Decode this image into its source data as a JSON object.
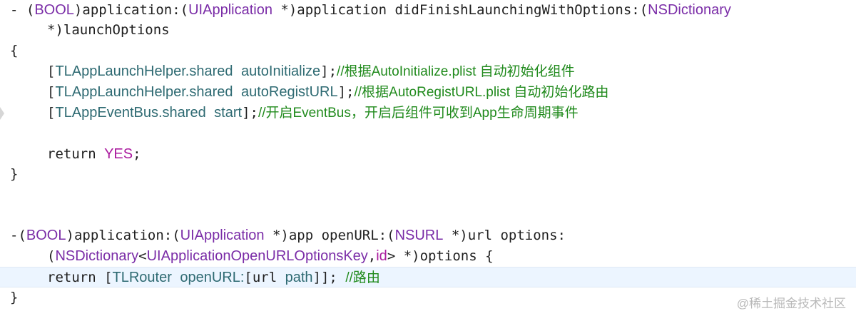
{
  "code": {
    "method1": {
      "minus": "- ",
      "open1": "(",
      "bool": "BOOL",
      "close1": ")",
      "sel1": "application:",
      "open2": "(",
      "uiapp": "UIApplication",
      "ptr1": " *)",
      "arg1": "application didFinishLaunchingWithOptions:",
      "open3": "(",
      "nsdict": "NSDictionary",
      "cont": "*)launchOptions",
      "brace_open": "{",
      "l1_open": "[",
      "l1_cls": "TLAppLaunchHelper.shared",
      "l1_space": " ",
      "l1_method": "autoInitialize",
      "l1_close": "];",
      "l1_comment": "//根据AutoInitialize.plist 自动初始化组件",
      "l2_open": "[",
      "l2_cls": "TLAppLaunchHelper.shared",
      "l2_space": " ",
      "l2_method": "autoRegistURL",
      "l2_close": "];",
      "l2_comment": "//根据AutoRegistURL.plist 自动初始化路由",
      "l3_open": "[",
      "l3_cls": "TLAppEventBus.shared",
      "l3_space": " ",
      "l3_method": "start",
      "l3_close": "];",
      "l3_comment": "//开启EventBus，开启后组件可收到App生命周期事件",
      "return_kw": "return ",
      "return_val": "YES",
      "return_end": ";",
      "brace_close": "}"
    },
    "method2": {
      "minus": "-",
      "open1": "(",
      "bool": "BOOL",
      "close1": ")",
      "sel1": "application:",
      "open2": "(",
      "uiapp": "UIApplication",
      "ptr1": " *)",
      "arg1": "app openURL:",
      "open3": "(",
      "nsurl": "NSURL",
      "ptr2": " *)",
      "arg2": "url options:",
      "c_open": "(",
      "nsdict": "NSDictionary",
      "lt": "<",
      "optkey": "UIApplicationOpenURLOptionsKey",
      "comma": ",",
      "id": "id",
      "gt": "> *)",
      "options": "options {",
      "return_kw": "return [",
      "router": "TLRouter",
      "space": " ",
      "openurl": "openURL:",
      "url_open": "[url ",
      "path": "path",
      "end": "]]; ",
      "comment": "//路由",
      "brace_close": "}"
    }
  },
  "watermark": "@稀土掘金技术社区"
}
